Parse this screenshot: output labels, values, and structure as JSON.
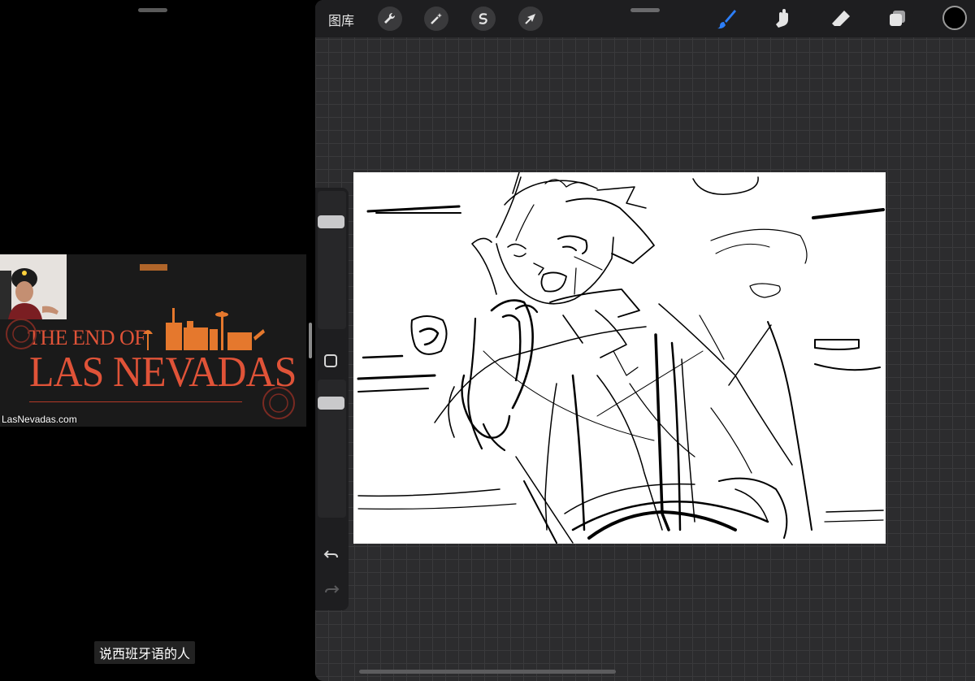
{
  "video": {
    "title_line1": "THE END OF",
    "title_line2": "LAS NEVADAS",
    "caption": "LasNevadas.com"
  },
  "subtitle": "说西班牙语的人",
  "procreate": {
    "gallery_label": "图库",
    "toolbar_icons": [
      "wrench-icon",
      "magic-wand-icon",
      "selection-icon",
      "move-arrow-icon"
    ],
    "right_tools": [
      "brush-icon",
      "smudge-icon",
      "eraser-icon",
      "layers-icon"
    ],
    "active_tool": "brush-icon",
    "current_color": "#000000",
    "accent_color": "#2d7ff9"
  }
}
